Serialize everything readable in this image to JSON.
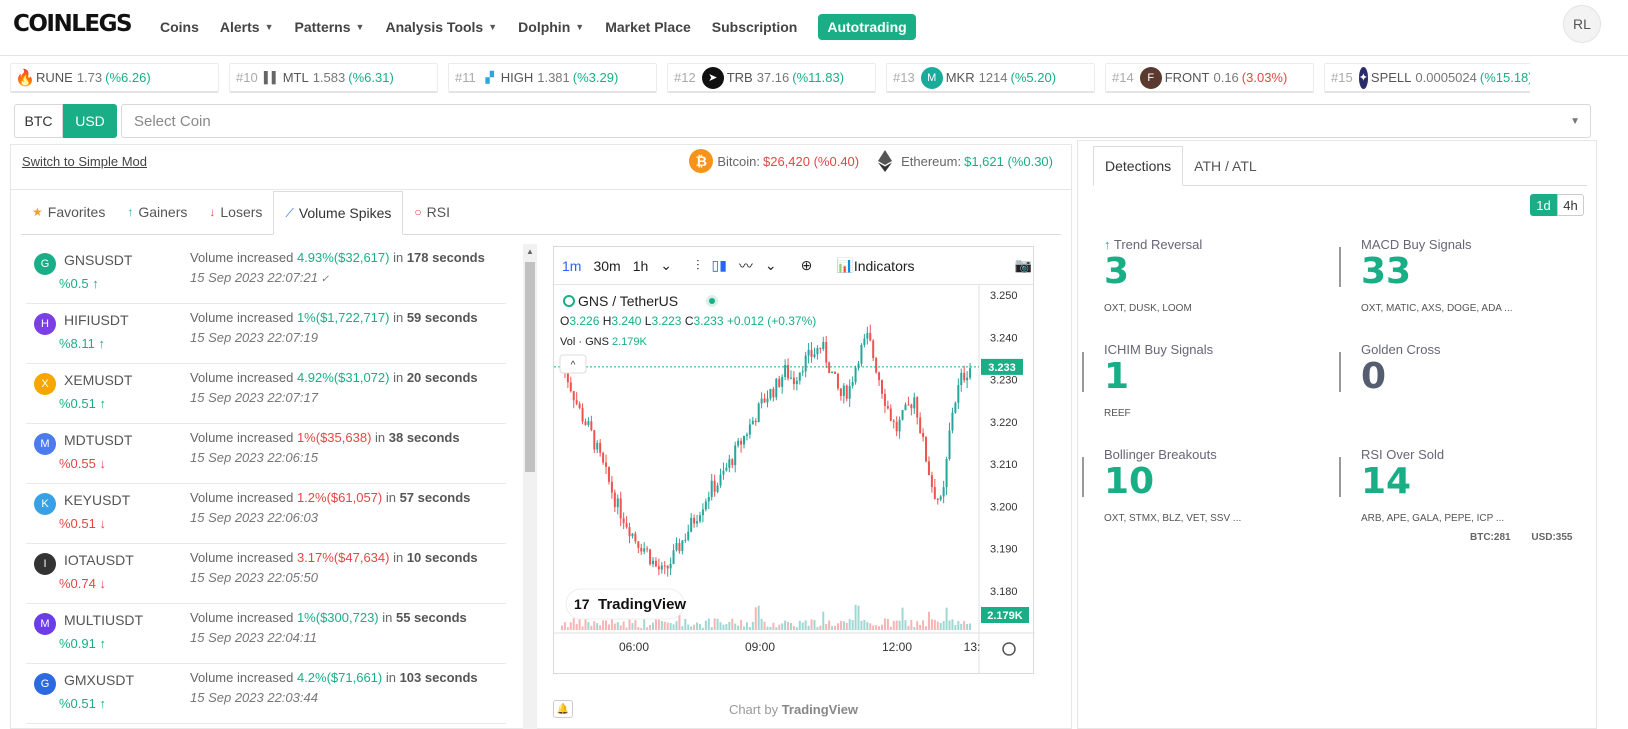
{
  "nav": {
    "logo": "COINLEGS",
    "avatar": "RL",
    "items": [
      {
        "label": "Coins",
        "caret": false
      },
      {
        "label": "Alerts",
        "caret": true
      },
      {
        "label": "Patterns",
        "caret": true
      },
      {
        "label": "Analysis Tools",
        "caret": true
      },
      {
        "label": "Dolphin",
        "caret": true
      },
      {
        "label": "Market Place",
        "caret": false
      },
      {
        "label": "Subscription",
        "caret": false
      }
    ],
    "autotrading": "Autotrading"
  },
  "ticker": [
    {
      "rank": "",
      "name": "RUNE",
      "price": "1.73",
      "change": "(%6.26)",
      "dir": "up",
      "icon": "fire-icon",
      "color": "#ff5722"
    },
    {
      "rank": "#10",
      "name": "MTL",
      "price": "1.583",
      "change": "(%6.31)",
      "dir": "up",
      "icon": "mtl-icon",
      "color": "#666666"
    },
    {
      "rank": "#11",
      "name": "HIGH",
      "price": "1.381",
      "change": "(%3.29)",
      "dir": "up",
      "icon": "high-icon",
      "color": "#2aa5e0"
    },
    {
      "rank": "#12",
      "name": "TRB",
      "price": "37.16",
      "change": "(%11.83)",
      "dir": "up",
      "icon": "trb-icon",
      "color": "#111111"
    },
    {
      "rank": "#13",
      "name": "MKR",
      "price": "1214",
      "change": "(%5.20)",
      "dir": "up",
      "icon": "mkr-icon",
      "color": "#1aab9b"
    },
    {
      "rank": "#14",
      "name": "FRONT",
      "price": "0.16",
      "change": "(3.03%)",
      "dir": "down",
      "icon": "front-icon",
      "color": "#5a3a2e"
    },
    {
      "rank": "#15",
      "name": "SPELL",
      "price": "0.0005024",
      "change": "(%15.18)",
      "dir": "up",
      "icon": "spell-icon",
      "color": "#2b2a6b"
    }
  ],
  "currency": {
    "btc": "BTC",
    "usd": "USD",
    "placeholder": "Select Coin"
  },
  "left": {
    "switch_mod": "Switch to Simple Mod",
    "bitcoin": {
      "label": "Bitcoin:",
      "value": "$26,420 (%0.40)"
    },
    "ethereum": {
      "label": "Ethereum:",
      "value": "$1,621 (%0.30)"
    }
  },
  "tabs": [
    {
      "label": "Favorites",
      "icon": "star-icon",
      "glyph": "★",
      "color": "#f0a020"
    },
    {
      "label": "Gainers",
      "icon": "arrow-up-icon",
      "glyph": "↑",
      "color": "#1aae86"
    },
    {
      "label": "Losers",
      "icon": "arrow-down-icon",
      "glyph": "↓",
      "color": "#e64545"
    },
    {
      "label": "Volume Spikes",
      "icon": "chart-line-icon",
      "glyph": "⟋",
      "color": "#2962ff",
      "active": true
    },
    {
      "label": "RSI",
      "icon": "circle-icon",
      "glyph": "○",
      "color": "#e64545"
    }
  ],
  "spikes": [
    {
      "symbol": "GNSUSDT",
      "pct": "%0.5",
      "dir": "up",
      "inc": "4.93%($32,617)",
      "secs": "178 seconds",
      "time": "15 Sep 2023 22:07:21",
      "check": true,
      "color": "#1aae86"
    },
    {
      "symbol": "HIFIUSDT",
      "pct": "%8.11",
      "dir": "up",
      "inc": "1%($1,722,717)",
      "secs": "59 seconds",
      "time": "15 Sep 2023 22:07:19",
      "check": false,
      "color": "#7b3fe4"
    },
    {
      "symbol": "XEMUSDT",
      "pct": "%0.51",
      "dir": "up",
      "inc": "4.92%($31,072)",
      "secs": "20 seconds",
      "time": "15 Sep 2023 22:07:17",
      "check": false,
      "color": "#f7a600"
    },
    {
      "symbol": "MDTUSDT",
      "pct": "%0.55",
      "dir": "down",
      "inc": "1%($35,638)",
      "secs": "38 seconds",
      "time": "15 Sep 2023 22:06:15",
      "check": false,
      "color": "#4b7bec"
    },
    {
      "symbol": "KEYUSDT",
      "pct": "%0.51",
      "dir": "down",
      "inc": "1.2%($61,057)",
      "secs": "57 seconds",
      "time": "15 Sep 2023 22:06:03",
      "check": false,
      "color": "#3aa0e6"
    },
    {
      "symbol": "IOTAUSDT",
      "pct": "%0.74",
      "dir": "down",
      "inc": "3.17%($47,634)",
      "secs": "10 seconds",
      "time": "15 Sep 2023 22:05:50",
      "check": false,
      "color": "#333333"
    },
    {
      "symbol": "MULTIUSDT",
      "pct": "%0.91",
      "dir": "up",
      "inc": "1%($300,723)",
      "secs": "55 seconds",
      "time": "15 Sep 2023 22:04:11",
      "check": false,
      "color": "#6a3de8"
    },
    {
      "symbol": "GMXUSDT",
      "pct": "%0.51",
      "dir": "up",
      "inc": "4.2%($71,661)",
      "secs": "103 seconds",
      "time": "15 Sep 2023 22:03:44",
      "check": false,
      "color": "#2d6ae0"
    }
  ],
  "spike_text": {
    "prefix": "Volume increased",
    "in": "in"
  },
  "chart": {
    "toolbar": [
      "1m",
      "30m",
      "1h"
    ],
    "indicators": "Indicators",
    "pair": "GNS / TetherUS",
    "ohlc": {
      "o": "3.226",
      "h": "3.240",
      "l": "3.223",
      "c": "3.233",
      "chg": "+0.012 (+0.37%)"
    },
    "vol_label": "Vol · GNS",
    "vol_value": "2.179K",
    "price_labels": [
      "3.250",
      "3.240",
      "3.230",
      "3.220",
      "3.210",
      "3.200",
      "3.190",
      "3.180"
    ],
    "last_price": "3.233",
    "last_vol": "2.179K",
    "time_labels": [
      "06:00",
      "09:00",
      "12:00",
      "13:"
    ],
    "brand": "TradingView",
    "chart_by_prefix": "Chart by",
    "chart_by_brand": "TradingView"
  },
  "right": {
    "tabs": [
      "Detections",
      "ATH / ATL"
    ],
    "tf": [
      "1d",
      "4h"
    ],
    "detections": [
      {
        "label": "Trend Reversal",
        "value": "3",
        "coins": "OXT, DUSK, LOOM",
        "color": "#1aae86",
        "arrow": true
      },
      {
        "label": "MACD Buy Signals",
        "value": "33",
        "coins": "OXT, MATIC, AXS, DOGE, ADA ...",
        "color": "#1aae86"
      },
      {
        "label": "ICHIM Buy Signals",
        "value": "1",
        "coins": "REEF",
        "color": "#1aae86"
      },
      {
        "label": "Golden Cross",
        "value": "0",
        "coins": "",
        "color": "#555e6e"
      },
      {
        "label": "Bollinger Breakouts",
        "value": "10",
        "coins": "OXT, STMX, BLZ, VET, SSV ...",
        "color": "#1aae86"
      },
      {
        "label": "RSI Over Sold",
        "value": "14",
        "coins": "ARB, APE, GALA, PEPE, ICP ...",
        "color": "#1aae86"
      }
    ],
    "counts": {
      "btc": "BTC:281",
      "usd": "USD:355"
    }
  }
}
